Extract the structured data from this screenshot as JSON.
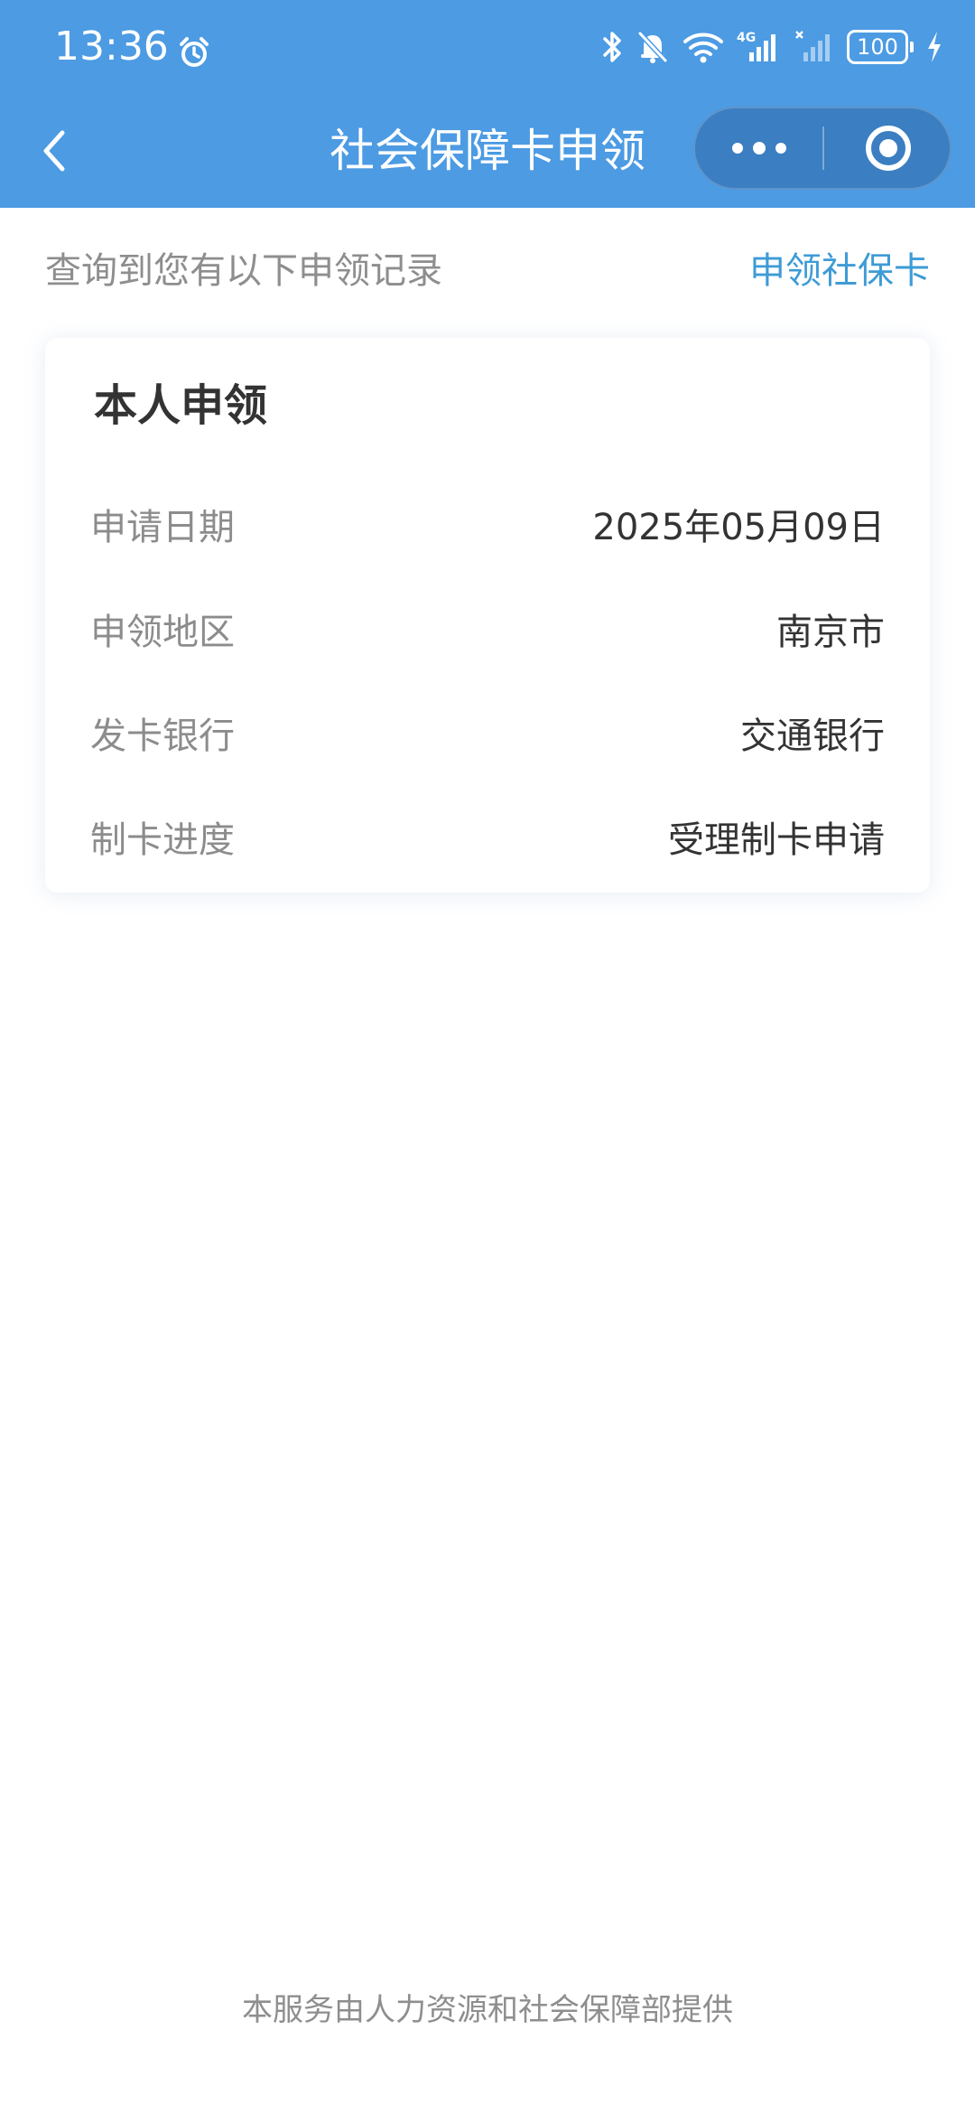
{
  "status_bar": {
    "time": "13:36",
    "battery": "100",
    "network": "4G"
  },
  "nav": {
    "title": "社会保障卡申领"
  },
  "records": {
    "hint": "查询到您有以下申领记录",
    "apply_link": "申领社保卡"
  },
  "card": {
    "title": "本人申领",
    "rows": [
      {
        "label": "申请日期",
        "value": "2025年05月09日"
      },
      {
        "label": "申领地区",
        "value": "南京市"
      },
      {
        "label": "发卡银行",
        "value": "交通银行"
      },
      {
        "label": "制卡进度",
        "value": "受理制卡申请"
      }
    ]
  },
  "footer": {
    "provider": "本服务由人力资源和社会保障部提供"
  },
  "colors": {
    "header_bg": "#4c9be3",
    "link": "#3e9bd6",
    "label": "#8c8c8c",
    "value": "#333333"
  }
}
